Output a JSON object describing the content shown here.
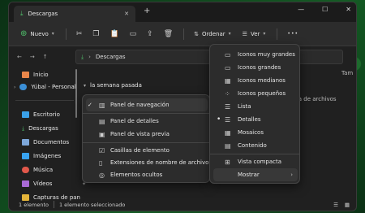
{
  "window": {
    "tab_title": "Descargas",
    "new_tab_symbol": "+",
    "minimize_symbol": "—",
    "maximize_symbol": "☐",
    "close_symbol": "✕"
  },
  "toolbar": {
    "new_label": "Nuevo",
    "sort_label": "Ordenar",
    "view_label": "Ver",
    "more_symbol": "•••"
  },
  "address": {
    "path_label": "Descargas"
  },
  "sidebar": {
    "items": [
      {
        "label": "Inicio",
        "icon": "home-icon",
        "color": "#e9864a"
      },
      {
        "label": "Yúbal - Personal",
        "icon": "cloud-icon",
        "color": "#3b8fd6"
      },
      {
        "label": "Escritorio",
        "icon": "desktop-icon",
        "color": "#3aa0e8"
      },
      {
        "label": "Descargas",
        "icon": "download-icon",
        "color": "#4fbf6a"
      },
      {
        "label": "Documentos",
        "icon": "documents-icon",
        "color": "#7da7d9"
      },
      {
        "label": "Imágenes",
        "icon": "images-icon",
        "color": "#38a2f0"
      },
      {
        "label": "Música",
        "icon": "music-icon",
        "color": "#e0584b"
      },
      {
        "label": "Vídeos",
        "icon": "videos-icon",
        "color": "#a96ad6"
      },
      {
        "label": "Capturas de pan",
        "icon": "folder-icon",
        "color": "#e5b53a"
      }
    ]
  },
  "main": {
    "group_header": "la semana pasada",
    "col_right_fragment": "Tam",
    "type_fragment": "ta de archivos"
  },
  "status": {
    "count": "1 elemento",
    "selected": "1 elemento seleccionado"
  },
  "show_menu": {
    "items": [
      {
        "label": "Panel de navegación",
        "checked": true,
        "icon": "navigation-pane-icon"
      },
      {
        "label": "Panel de detalles",
        "checked": false,
        "icon": "details-pane-icon"
      },
      {
        "label": "Panel de vista previa",
        "checked": false,
        "icon": "preview-pane-icon"
      },
      {
        "label": "Casillas de elemento",
        "checked": false,
        "icon": "checkbox-icon"
      },
      {
        "label": "Extensiones de nombre de archivo",
        "checked": false,
        "icon": "extensions-icon"
      },
      {
        "label": "Elementos ocultos",
        "checked": false,
        "icon": "hidden-items-icon"
      }
    ],
    "check_symbol": "✓"
  },
  "view_menu": {
    "items": [
      {
        "label": "Iconos muy grandes",
        "icon": "extra-large-icons-icon",
        "selected": false
      },
      {
        "label": "Iconos grandes",
        "icon": "large-icons-icon",
        "selected": false
      },
      {
        "label": "Iconos medianos",
        "icon": "medium-icons-icon",
        "selected": false
      },
      {
        "label": "Iconos pequeños",
        "icon": "small-icons-icon",
        "selected": false
      },
      {
        "label": "Lista",
        "icon": "list-icon",
        "selected": false
      },
      {
        "label": "Detalles",
        "icon": "details-icon",
        "selected": true
      },
      {
        "label": "Mosaicos",
        "icon": "tiles-icon",
        "selected": false
      },
      {
        "label": "Contenido",
        "icon": "content-icon",
        "selected": false
      },
      {
        "label": "Vista compacta",
        "icon": "compact-view-icon",
        "selected": false
      },
      {
        "label": "Mostrar",
        "icon": "",
        "selected": false
      }
    ],
    "dot_symbol": "•",
    "submenu_chevron": "›"
  },
  "colors": {
    "accent": "#4fbf6a",
    "menu_bg": "#2c2c2c",
    "window_bg": "#202020"
  }
}
